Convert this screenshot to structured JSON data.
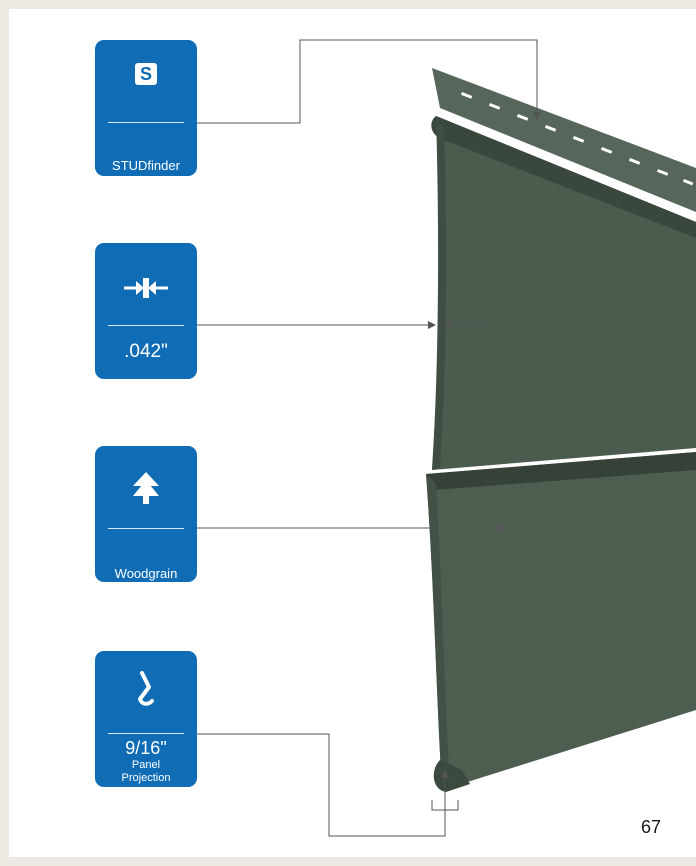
{
  "features": {
    "studfinder": {
      "icon": "s-letter-icon",
      "symbol": "S",
      "label": "STUDfinder"
    },
    "thickness": {
      "icon": "thickness-arrows-icon",
      "label": ".042\""
    },
    "texture": {
      "icon": "tree-icon",
      "label": "Woodgrain"
    },
    "projection": {
      "icon": "profile-curve-icon",
      "value": "9/16\"",
      "label_line1": "Panel",
      "label_line2": "Projection"
    }
  },
  "page_number": "67",
  "colors": {
    "badge": "#0f6cb5",
    "panel": "#4a5a4c",
    "page_bg": "#ece9e3"
  }
}
